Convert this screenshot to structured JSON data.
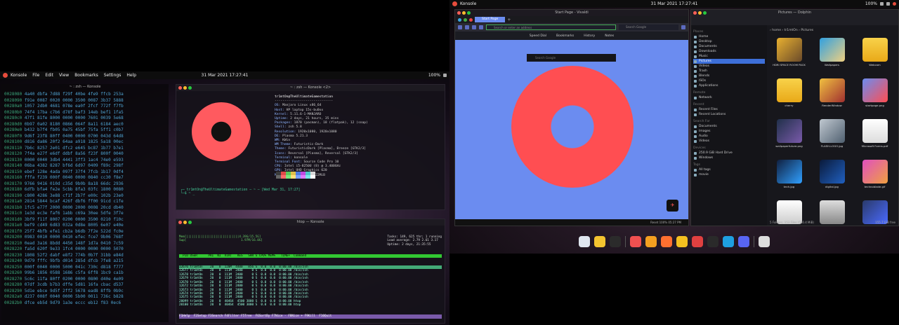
{
  "left": {
    "topbar": {
      "app": "Konsole",
      "menus": [
        "File",
        "Edit",
        "View",
        "Bookmarks",
        "Settings",
        "Help"
      ],
      "clock": "31 Mar 2021  17:27:41",
      "battery": "100%"
    },
    "hex_title": "~ : zsh — Konsole",
    "hex_rows": [
      [
        "0028080",
        "4a40 dbfa 7d88 f29f 40be 4fe9 ffcb 253a"
      ],
      [
        "0028090",
        "f91e 0087 0020 0000 3500 0087 3b37 5888"
      ],
      [
        "00280a0",
        "1057 2db0 4681 078e ea0f 2fcf 772f f7fb"
      ],
      [
        "00280b0",
        "74f4 17ba c7b6 d78f baf3 14eb bef1 1fa5"
      ],
      [
        "00280c0",
        "47f1 81fe 8000 0000 0000 7601 0039 5e68"
      ],
      [
        "00280d0",
        "0b97 0a02 8180 0866 064f 8a11 6184 aec0"
      ],
      [
        "00280e0",
        "b432 b7f4 fb05 0a75 45bf 75fa 5ff1 c0b7"
      ],
      [
        "00280f0",
        "9d6f 23f8 80ff 0400 0000 0700 043d 64d8"
      ],
      [
        "0028100",
        "d816 da86 20f2 64aa a918 1825 5a18 00ec"
      ],
      [
        "0028110",
        "7b6c 8257 2e01 dfc2 e645 bc87 1b77 b7e1"
      ],
      [
        "0028120",
        "7f4a e27f e6df ddbf 8a56 f23f 800f 0040"
      ],
      [
        "0028130",
        "0000 0040 3db4 4441 3ff3 1ac4 74e0 e593"
      ],
      [
        "0028140",
        "06ba 4382 8287 bf6d 6d97 0409 f89c 298f"
      ],
      [
        "0028150",
        "ebef 128e 4ada 097f 37f4 7fcb 1b17 0df4"
      ],
      [
        "0028160",
        "fffa f239 000f 0040 0000 0840 cc30 f8e7"
      ],
      [
        "0028170",
        "9766 9416 010d c35d 9b0b 8a18 66dc 2936"
      ],
      [
        "0028180",
        "6dfb bfa4 fe2e 5cbb 8fa3 03fc 1800 0080"
      ],
      [
        "0028190",
        "c800 4286 3e88 cf1f 2b7f e00c 102b 23e0"
      ],
      [
        "00281a0",
        "2814 5844 bcaf 426f dbf6 ff00 91cd c1fe"
      ],
      [
        "00281b0",
        "1fc5 e77f 2000 0000 2000 0008 20cd db40"
      ],
      [
        "00281c0",
        "1e3d ec3e faf6 1abb c69a 30ee 5dfe 3f7e"
      ],
      [
        "00281d0",
        "3bf9 f11f 8007 0200 0000 3500 0210 f10c"
      ],
      [
        "00281e0",
        "bef9 cd49 6d83 032a 0d8e 8005 6e07 e40e"
      ],
      [
        "00281f0",
        "25f7 4bfb efe1 cb2a b6db 7f2e 522d fc0e"
      ],
      [
        "0028200",
        "0983 0010 0000 0410 efec fce7 9b06 768f"
      ],
      [
        "0028210",
        "0ead 3a16 8bdd 4450 148f 1d7a 0410 7c59"
      ],
      [
        "0028220",
        "fa5d 620f 9e33 1fc4 0000 0000 0000 5070"
      ],
      [
        "0028230",
        "1808 52f2 dabf e8f2 774b 0b7f 31bb e84d"
      ],
      [
        "0028240",
        "9d79 fffc 9bfb d014 285d dfcb 7fe8 a215"
      ],
      [
        "0028250",
        "000f 0040 0000 5000 041c 730c d818 f777"
      ],
      [
        "0028260",
        "99b6 1856 0588 1686 c5fa 6ff8 1bc9 ca1b"
      ],
      [
        "0028270",
        "5c6c 11fa 80ff 0200 0000 0800 d40e 4e09"
      ],
      [
        "0028280",
        "07df 3cdb b7b3 dffe 5d81 16fa cbac d537"
      ],
      [
        "0028290",
        "5d1e ebce 9d5f 2ff2 5678 ead8 8ffb 0b9c"
      ],
      [
        "00282a0",
        "d237 008f 0040 0000 5b00 0011 736c b828"
      ],
      [
        "00282b0",
        "dfce eb5d 9d79 1a3e eccc eb12 f83 0ec6"
      ]
    ],
    "neofetch": {
      "title": "~ : zsh — Konsole <2>",
      "user": "tr1mtOn@TheUltimateGamestation",
      "lines": [
        [
          "OS:",
          "Manjaro Linux x86_64"
        ],
        [
          "Host:",
          "HP laptop 15s-bu0xx"
        ],
        [
          "Kernel:",
          "5.11.6-1-MANJARO"
        ],
        [
          "Uptime:",
          "2 days, 21 hours, 35 mins"
        ],
        [
          "Packages:",
          "1870 (pacman), 18 (flatpak), 12 (snap)"
        ],
        [
          "Shell:",
          "zsh 5.8"
        ],
        [
          "Resolution:",
          "1920x1080, 1920x1080"
        ],
        [
          "DE:",
          "Plasma 5.21.3"
        ],
        [
          "WM:",
          "KWin"
        ],
        [
          "WM Theme:",
          "Futuristic-Dark"
        ],
        [
          "Theme:",
          "FuturisticDark [Plasma], Breeze [GTK2/3]"
        ],
        [
          "Icons:",
          "Reversal [Plasma], Reversal [GTK2/3]"
        ],
        [
          "Terminal:",
          "konsole"
        ],
        [
          "Terminal Font:",
          "Source Code Pro 10"
        ],
        [
          "CPU:",
          "Intel i5-8250U (8) @ 3.400GHz"
        ],
        [
          "GPU:",
          "Intel UHD Graphics 620"
        ],
        [
          "Memory:",
          "4451MiB / 15822MiB"
        ]
      ],
      "prompt": "┌─ tr1mtOn@TheUltimateGamestation — ~ — [Wed Mar 31, 17:27]\n└─$ ~ _",
      "palette": [
        "#3b3b3b",
        "#e04a4a",
        "#5ac85a",
        "#e0c04a",
        "#4a7ae0",
        "#c04ae0",
        "#4ac8c8",
        "#d8d8d8",
        "#666666",
        "#ff6a6a",
        "#7ae87a",
        "#ffe07a",
        "#7aa0ff",
        "#e07aff",
        "#7ae8e8",
        "#ffffff"
      ]
    },
    "htop": {
      "title": "htop — Konsole",
      "summary": "Tasks: 149, 625 thr; 1 running\nLoad average: 2.79 2.61 3.17\nUptime: 2 days, 21:35:55",
      "mem": "Mem[|||||||||||||||||||||||||||||4.39G/15.5G]\nSwp[                              1.97M/16.0G]",
      "header": "  PID USER      PRI  NI  VIRT   RES   SHR S CPU% MEM%   TIME+  Command",
      "rows": [
        "12676 tr1mtOn    20   0  120M  4400   856 S  0.0  0.0  0:00.00 /bin/zsh",
        "12677 tr1mtOn    20   0  111M  2400     0 S  0.0  0.0  0:00.00 /bin/zsh",
        "12678 tr1mtOn    20   0  111M  2400     0 S  0.0  0.0  0:00.00 /bin/zsh",
        "12679 tr1mtOn    20   0  111M  2400     0 S  0.0  0.0  0:00.00 /bin/zsh",
        "12670 tr1mtOn    20   0  111M  2400     0 S  0.0  0.0  0:00.00 /bin/zsh",
        "12672 tr1mtOn    20   0  111M  2400     0 S  0.0  0.0  0:00.00 /bin/zsh",
        "12673 tr1mtOn    20   0  111M  2400     0 S  0.0  0.0  0:00.00 /bin/zsh",
        "12674 tr1mtOn    20   0  111M  2400     0 S  0.0  0.0  0:00.00 /bin/zsh",
        "12675 tr1mtOn    20   0  111M  2400     0 S  0.0  0.0  0:00.00 /bin/zsh",
        "20099 tr1mtOn    20   0  40464  4500 3000 S  0.0  0.0  0:00.00 htop",
        "20100 tr1mtOn    20   0  40464  4500 3000 S  0.0  0.0  0:00.00 htop"
      ],
      "footer": "F1Help  F2Setup F3Search F4Filter F5Tree  F6SortBy F7Nice - F8Nice + F9Kill  F10Quit"
    }
  },
  "right": {
    "topbar": {
      "app": "Konsole",
      "clock": "31 Mar 2021  17:27:41",
      "battery": "100%"
    },
    "browser": {
      "title": "Start Page - Vivaldi",
      "tab": "Start Page",
      "url_placeholder": "Search or enter an address",
      "search_placeholder": "Search Google",
      "bar": [
        "Speed Dial",
        "Bookmarks",
        "History",
        "Notes"
      ],
      "sd_search_placeholder": "Search Google",
      "status": "Reset  100%  05:27 PM"
    },
    "files": {
      "title": "Pictures — Dolphin",
      "breadcrumb": "›  home  ›  tr1mtOn  ›  Pictures",
      "sections": [
        {
          "name": "Places",
          "items": [
            "Home",
            "Desktop",
            "Documents",
            "Downloads",
            "Music",
            "Pictures",
            "Videos",
            "Trash",
            "Blends",
            "ISOs",
            "Applications"
          ]
        },
        {
          "name": "Remote",
          "items": [
            "Network"
          ]
        },
        {
          "name": "Recent",
          "items": [
            "Recent Files",
            "Recent Locations"
          ]
        },
        {
          "name": "Search For",
          "items": [
            "Documents",
            "Images",
            "Audio",
            "Videos"
          ]
        },
        {
          "name": "Devices",
          "items": [
            "250.9 GiB Hard Drive",
            "Windows"
          ]
        },
        {
          "name": "Tags",
          "items": [
            "All tags",
            "movie"
          ]
        }
      ],
      "active_item": "Pictures",
      "grid": [
        {
          "name": "HDRI SPACE ROOM PACK",
          "kind": "folder"
        },
        {
          "name": "Wallpapers",
          "kind": "folder"
        },
        {
          "name": "Webcam",
          "kind": "folder"
        },
        {
          "name": "cherry",
          "kind": "folder"
        },
        {
          "name": "RenderWindow",
          "kind": "folder"
        },
        {
          "name": "startpage.png",
          "kind": "image"
        },
        {
          "name": "wallpaperfuture.png",
          "kind": "image"
        },
        {
          "name": "FLASH-LOGO.jpg",
          "kind": "image"
        },
        {
          "name": "Microsoft Forms.pdf",
          "kind": "doc"
        },
        {
          "name": "tech.jpg",
          "kind": "image"
        },
        {
          "name": "digital.jpg",
          "kind": "image"
        },
        {
          "name": "technoblade.gif",
          "kind": "image"
        },
        {
          "name": "",
          "kind": "image"
        },
        {
          "name": "",
          "kind": "image"
        },
        {
          "name": "",
          "kind": "image"
        }
      ],
      "status_left": "5 Folders, 153 Files (580.4 MiB)",
      "status_right": "155.7 GiB free"
    },
    "dock_colors": [
      "#dfe6ef",
      "#f4c430",
      "#2b2b2b",
      "#f05050",
      "#f4a020",
      "#ff7030",
      "#f4c020",
      "#e04040",
      "#2a2a2a",
      "#1ea0e0",
      "#5865f2",
      "#dddddd"
    ]
  }
}
